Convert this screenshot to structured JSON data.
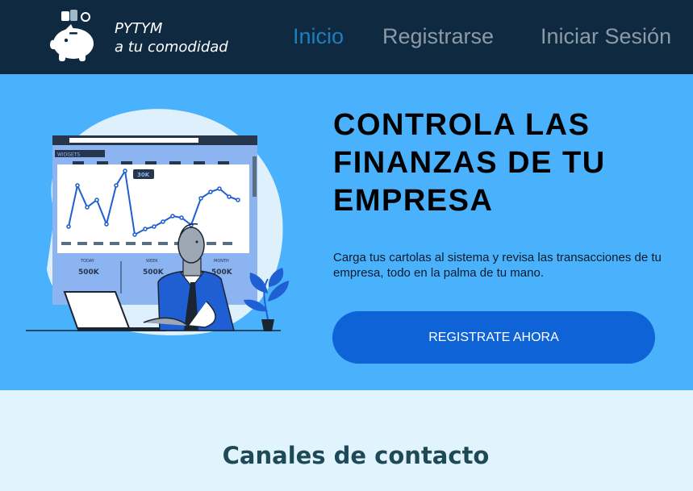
{
  "brand": {
    "name": "PYTYM",
    "tagline": "a tu comodidad"
  },
  "nav": {
    "items": [
      {
        "label": "Inicio",
        "active": true
      },
      {
        "label": "Registrarse",
        "active": false
      },
      {
        "label": "Iniciar Sesión",
        "active": false
      }
    ]
  },
  "hero": {
    "title": "CONTROLA LAS FINANZAS DE TU EMPRESA",
    "description": "Carga tus cartolas al sistema y revisa las transacciones de tu empresa, todo en la palma de tu mano.",
    "cta_label": "REGISTRATE AHORA",
    "illustration": {
      "chart_tag": "WIDGETS",
      "badge": "30K",
      "stats": [
        {
          "label": "TODAY",
          "value": "500K"
        },
        {
          "label": "WEEK",
          "value": "500K"
        },
        {
          "label": "MONTH",
          "value": "500K"
        }
      ]
    }
  },
  "contact": {
    "heading": "Canales de contacto"
  },
  "colors": {
    "navbar_bg": "#0f2a40",
    "nav_active": "#1c7fbf",
    "nav_inactive": "#8b9aa8",
    "hero_bg": "#4ab2fd",
    "cta_bg": "#0e63d6",
    "page_bg": "#e1f3fd",
    "heading": "#1e4a57"
  }
}
